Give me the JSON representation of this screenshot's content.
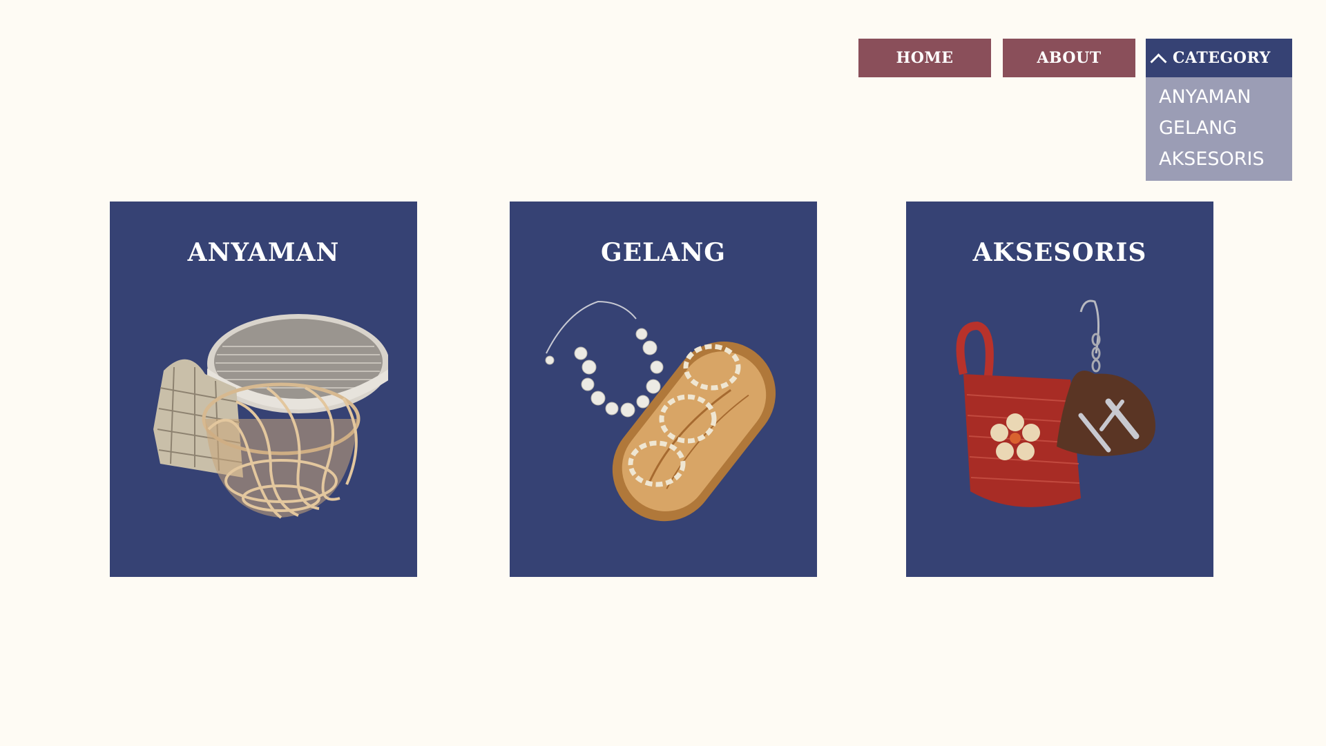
{
  "colors": {
    "background": "#fefbf4",
    "nav_button": "#8a4f5a",
    "nav_active": "#364274",
    "dropdown_bg": "#9b9db5",
    "card_bg": "#364274"
  },
  "nav": {
    "home": "HOME",
    "about": "ABOUT",
    "category": "CATEGORY",
    "category_icon": "chevron-up-icon"
  },
  "dropdown": {
    "items": [
      "ANYAMAN",
      "GELANG",
      "AKSESORIS"
    ]
  },
  "cards": [
    {
      "title": "ANYAMAN",
      "image": "woven-baskets-image"
    },
    {
      "title": "GELANG",
      "image": "bracelets-image"
    },
    {
      "title": "AKSESORIS",
      "image": "accessories-image"
    }
  ]
}
